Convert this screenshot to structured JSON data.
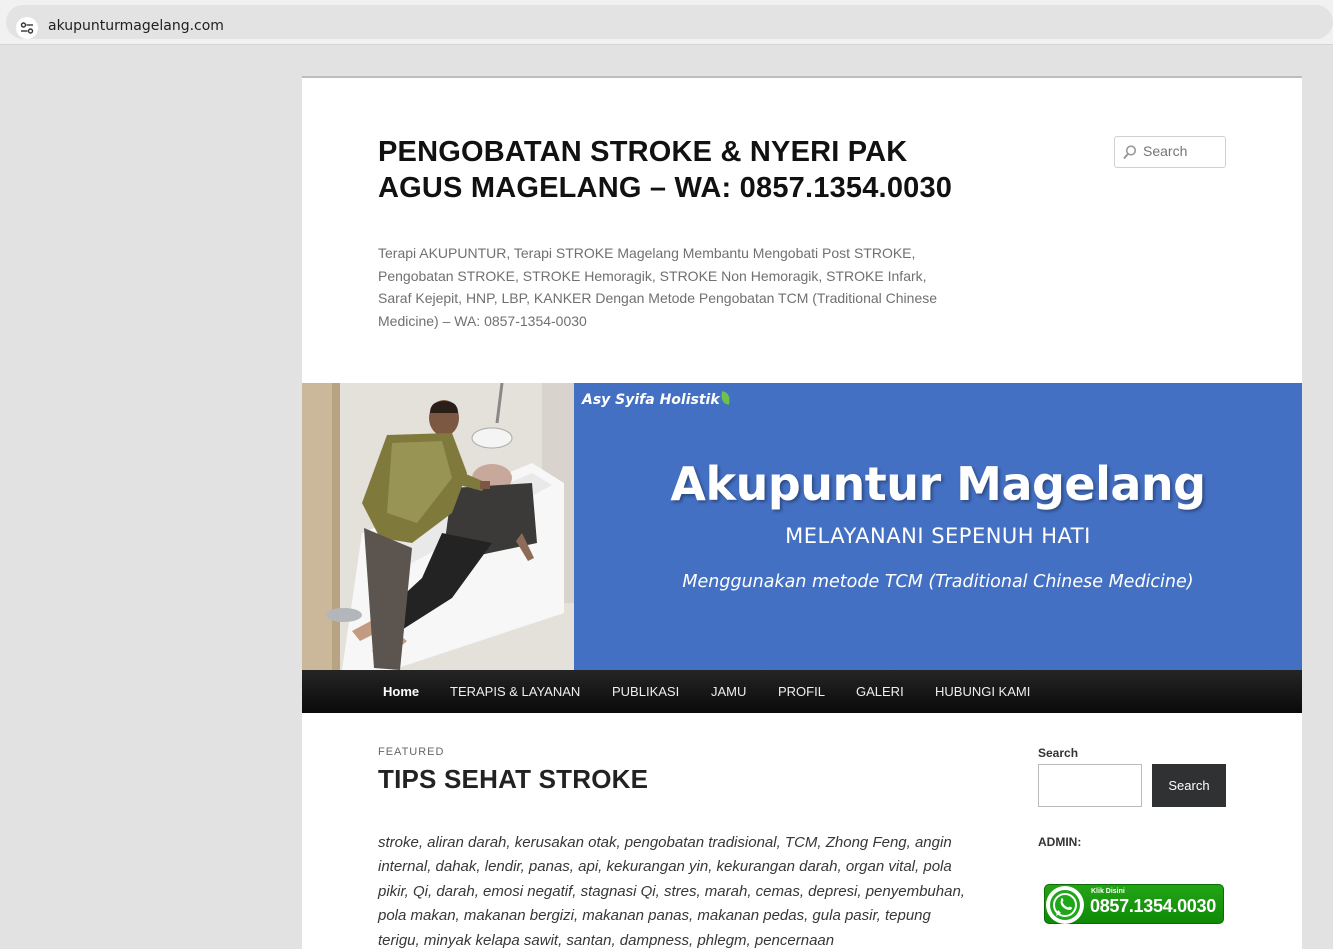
{
  "browser": {
    "url": "akupunturmagelang.com",
    "site_info_icon": "tune-icon"
  },
  "header": {
    "title": "PENGOBATAN STROKE & NYERI PAK AGUS MAGELANG – WA: 0857.1354.0030",
    "description": "Terapi AKUPUNTUR, Terapi STROKE Magelang Membantu Mengobati Post STROKE, Pengobatan STROKE, STROKE Hemoragik, STROKE Non Hemoragik, STROKE Infark, Saraf Kejepit, HNP, LBP, KANKER Dengan Metode Pengobatan TCM (Traditional Chinese Medicine) – WA: 0857-1354-0030",
    "search_placeholder": "Search"
  },
  "banner": {
    "brand": "Asy Syifa Holistik",
    "title": "Akupuntur Magelang",
    "subtitle": "MELAYANANI SEPENUH HATI",
    "method": "Menggunakan metode TCM (Traditional Chinese Medicine)",
    "background_color": "#4470c4"
  },
  "nav": {
    "items": [
      {
        "label": "Home",
        "active": true
      },
      {
        "label": "TERAPIS & LAYANAN"
      },
      {
        "label": "PUBLIKASI"
      },
      {
        "label": "JAMU"
      },
      {
        "label": "PROFIL"
      },
      {
        "label": "GALERI"
      },
      {
        "label": "HUBUNGI KAMI"
      }
    ]
  },
  "post": {
    "label": "FEATURED",
    "title": "TIPS SEHAT STROKE",
    "body": "stroke, aliran darah, kerusakan otak, pengobatan tradisional, TCM, Zhong Feng, angin internal, dahak, lendir, panas, api, kekurangan yin, kekurangan darah, organ vital, pola pikir, Qi, darah, emosi negatif, stagnasi Qi, stres, marah, cemas, depresi, penyembuhan, pola makan, makanan bergizi, makanan panas, makanan pedas, gula pasir, tepung terigu, minyak kelapa sawit, santan, dampness, phlegm, pencernaan"
  },
  "sidebar": {
    "search_label": "Search",
    "search_button": "Search",
    "admin_label": "ADMIN:",
    "wa_klik": "Klik Disini",
    "wa_number": "0857.1354.0030",
    "wa_color": "#1a9a10"
  }
}
